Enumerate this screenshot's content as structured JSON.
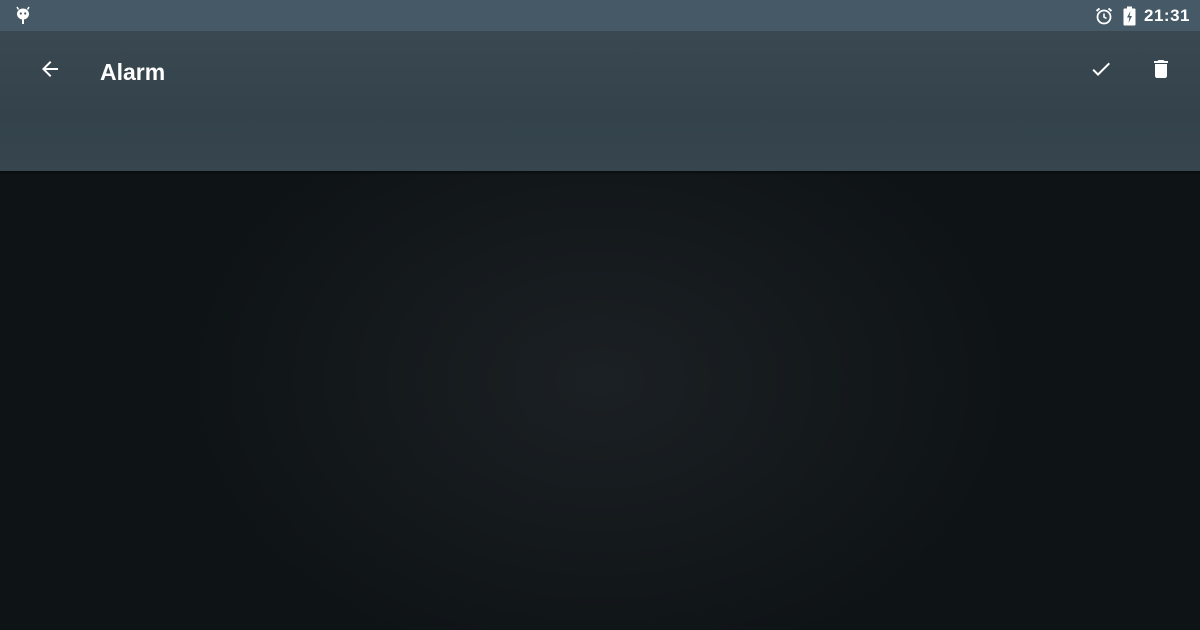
{
  "status_bar": {
    "left_icon": "android-debug-icon",
    "right_icons": [
      "alarm-clock-icon",
      "battery-charging-icon"
    ],
    "time": "21:31"
  },
  "app_bar": {
    "back_icon": "arrow-back-icon",
    "title": "Alarm",
    "actions": [
      "check-icon",
      "delete-icon"
    ]
  },
  "colors": {
    "status_bar": "#455a66",
    "app_bar": "#37474f",
    "background": "#12171a",
    "icon": "#ffffff"
  }
}
